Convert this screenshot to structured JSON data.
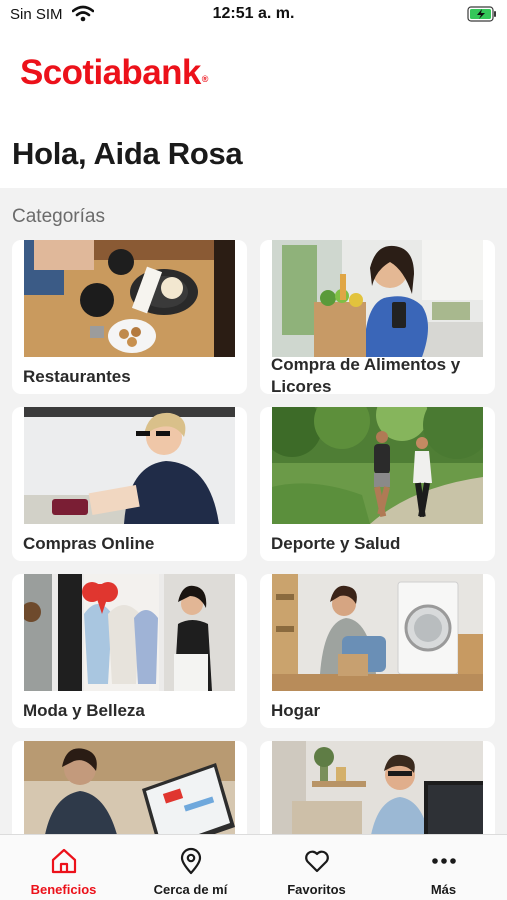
{
  "status_bar": {
    "carrier": "Sin SIM",
    "time": "12:51 a. m."
  },
  "header": {
    "logo": "Scotiabank",
    "greeting": "Hola, Aida Rosa"
  },
  "categories": {
    "title": "Categorías",
    "items": [
      {
        "label": "Restaurantes"
      },
      {
        "label": "Compra de Alimentos y Licores"
      },
      {
        "label": "Compras Online"
      },
      {
        "label": "Deporte y Salud"
      },
      {
        "label": "Moda y Belleza"
      },
      {
        "label": "Hogar"
      }
    ]
  },
  "tab_bar": {
    "items": [
      {
        "label": "Beneficios",
        "icon": "home-icon",
        "active": true
      },
      {
        "label": "Cerca de mí",
        "icon": "location-pin-icon"
      },
      {
        "label": "Favoritos",
        "icon": "heart-icon"
      },
      {
        "label": "Más",
        "icon": "more-dots-icon"
      }
    ]
  },
  "colors": {
    "brand_red": "#ec111a",
    "background": "#f2f2f2",
    "card": "#ffffff"
  }
}
